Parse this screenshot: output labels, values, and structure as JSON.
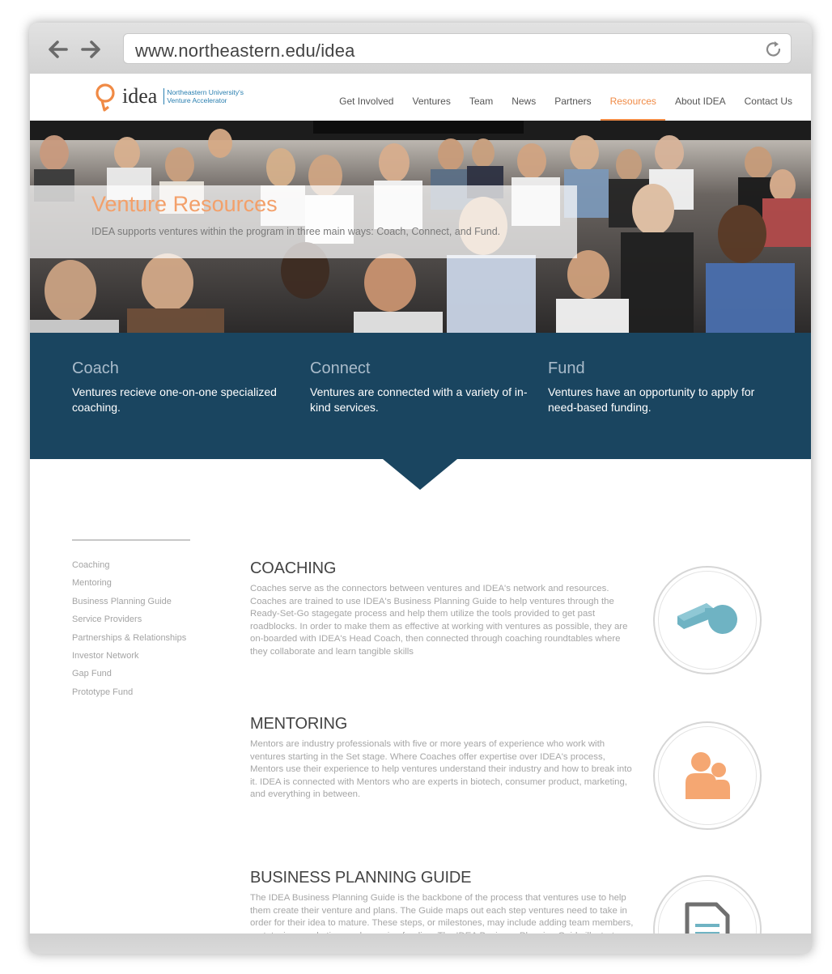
{
  "browser": {
    "url": "www.northeastern.edu/idea"
  },
  "site": {
    "logo_word": "idea",
    "logo_tagline_1": "Northeastern University's",
    "logo_tagline_2": "Venture Accelerator",
    "nav": [
      {
        "label": "Get Involved"
      },
      {
        "label": "Ventures"
      },
      {
        "label": "Team"
      },
      {
        "label": "News"
      },
      {
        "label": "Partners"
      },
      {
        "label": "Resources",
        "active": true
      },
      {
        "label": "About IDEA"
      },
      {
        "label": "Contact Us"
      }
    ],
    "accent_color": "#f08a45",
    "band_color": "#1a4560"
  },
  "hero": {
    "title": "Venture Resources",
    "subtitle": "IDEA supports ventures within the program in three main ways: Coach, Connect, and Fund."
  },
  "band": {
    "columns": [
      {
        "title": "Coach",
        "text": "Ventures recieve one-on-one specialized coaching."
      },
      {
        "title": "Connect",
        "text": "Ventures are connected with a variety of in-kind services."
      },
      {
        "title": "Fund",
        "text": "Ventures have an opportunity to apply for need-based funding."
      }
    ]
  },
  "sidebar": {
    "items": [
      {
        "label": "Coaching"
      },
      {
        "label": "Mentoring"
      },
      {
        "label": "Business Planning Guide"
      },
      {
        "label": "Service Providers"
      },
      {
        "label": "Partnerships & Relationships"
      },
      {
        "label": "Investor Network"
      },
      {
        "label": "Gap Fund"
      },
      {
        "label": "Prototype Fund"
      }
    ]
  },
  "sections": [
    {
      "title": "COACHING",
      "icon": "whistle-icon",
      "text": "Coaches serve as the connectors between ventures and IDEA's network and resources. Coaches are trained to use IDEA's Business Planning Guide to help ventures through the Ready-Set-Go stagegate process and help them utilize the tools provided to get past roadblocks. In order to make them as effective at working with ventures as possible, they are on-boarded with IDEA's Head Coach, then connected through coaching roundtables where they collaborate and learn tangible skills"
    },
    {
      "title": "MENTORING",
      "icon": "people-icon",
      "text": "Mentors are industry professionals with five or more years of experience who work with ventures starting in the Set stage. Where Coaches offer expertise over IDEA's process, Mentors use their experience to help ventures understand their industry and how to break into it. IDEA is connected with Mentors who are experts in biotech, consumer product, marketing, and everything in between."
    },
    {
      "title": "BUSINESS PLANNING GUIDE",
      "icon": "document-icon",
      "text": "The IDEA Business Planning Guide is the backbone of the process that ventures use to help them create their venture and plans. The Guide maps out each step ventures need to take in order for their idea to mature. These steps, or milestones, may include adding team members, prototyping, marketing, and pursuing funding. The IDEA Business Planning Guide illustrates the entrepreneurial journey through the different venture stages of Ready,"
    }
  ]
}
